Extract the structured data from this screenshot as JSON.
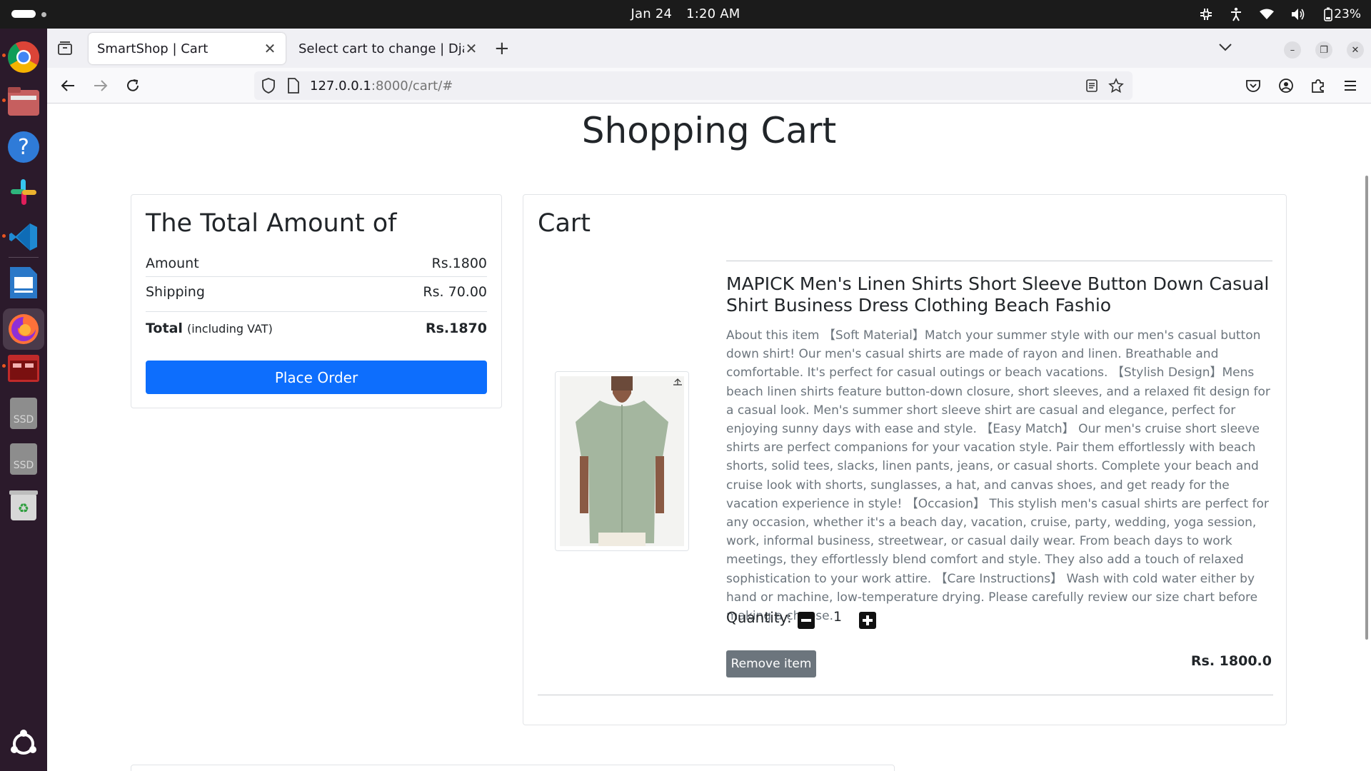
{
  "system": {
    "date": "Jan 24",
    "time": "1:20 AM",
    "battery": "23%"
  },
  "dock": {
    "apps": [
      "chrome-icon",
      "files-icon",
      "help-icon",
      "slack-icon",
      "vscode-icon",
      "writer-icon",
      "firefox-icon",
      "terminal-icon",
      "ssd-drive-icon",
      "ssd-drive-icon",
      "trash-icon",
      "ubuntu-apps-icon"
    ],
    "ssd_label": "SSD"
  },
  "browser": {
    "tabs": [
      {
        "title": "SmartShop | Cart",
        "active": true
      },
      {
        "title": "Select cart to change | Djang",
        "active": false
      }
    ],
    "url_host": "127.0.0.1",
    "url_path": ":8000/cart/#"
  },
  "page": {
    "title": "Shopping Cart"
  },
  "summary": {
    "heading": "The Total Amount of",
    "amount_label": "Amount",
    "amount_value": "Rs.1800",
    "shipping_label": "Shipping",
    "shipping_value": "Rs. 70.00",
    "total_label": "Total",
    "total_note": "(including VAT)",
    "total_value": "Rs.1870",
    "place_order_label": "Place Order"
  },
  "cart": {
    "heading": "Cart",
    "items": [
      {
        "title": "MAPICK Men's Linen Shirts Short Sleeve Button Down Casual Shirt Business Dress Clothing Beach Fashio",
        "description": "About this item 【Soft Material】Match your summer style with our men's casual button down shirt! Our men's casual shirts are made of rayon and linen. Breathable and comfortable. It's perfect for casual outings or beach vacations. 【Stylish Design】Mens beach linen shirts feature button-down closure, short sleeves, and a relaxed fit design for a casual look. Men's summer short sleeve shirt are casual and elegance, perfect for enjoying sunny days with ease and style. 【Easy Match】 Our men's cruise short sleeve shirts are perfect companions for your vacation style. Pair them effortlessly with beach shorts, solid tees, slacks, linen pants, jeans, or casual shorts. Complete your beach and cruise look with shorts, sunglasses, a hat, and canvas shoes, and get ready for the vacation experience in style! 【Occasion】 This stylish men's casual shirts are perfect for any occasion, whether it's a beach day, vacation, cruise, party, wedding, yoga session, work, informal business, streetwear, or casual daily wear. From beach days to work meetings, they effortlessly blend comfort and style. They also add a touch of relaxed sophistication to your work attire. 【Care Instructions】 Wash with cold water either by hand or machine, low-temperature drying. Please carefully review our size chart before making a choose.",
        "quantity_label": "Quantity:",
        "quantity": "1",
        "remove_label": "Remove item",
        "price": "Rs. 1800.0"
      }
    ]
  },
  "colors": {
    "primary": "#0d6efd",
    "secondary": "#6c757d",
    "topbar": "#1b1b1b",
    "dock": "#2b1a2b",
    "shirt": "#9fb39a"
  }
}
